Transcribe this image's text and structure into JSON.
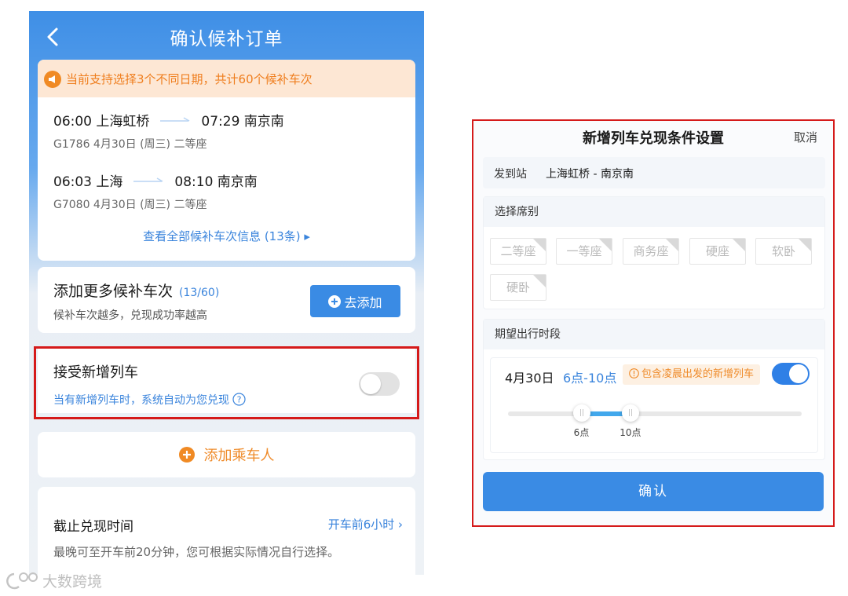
{
  "left": {
    "header": {
      "title": "确认候补订单"
    },
    "notice": {
      "text": "当前支持选择3个不同日期，共计60个候补车次"
    },
    "trains": [
      {
        "depart": "06:00 上海虹桥",
        "arrive": "07:29 南京南",
        "detail": "G1786   4月30日 (周三) 二等座"
      },
      {
        "depart": "06:03 上海",
        "arrive": "08:10 南京南",
        "detail": "G7080   4月30日 (周三) 二等座"
      }
    ],
    "view_all": "查看全部候补车次信息 (13条) ▸",
    "add_more": {
      "title": "添加更多候补车次",
      "count": "(13/60)",
      "subtitle": "候补车次越多，兑现成功率越高",
      "button": "去添加"
    },
    "accept_new": {
      "title": "接受新增列车",
      "subtitle": "当有新增列车时，系统自动为您兑现",
      "toggle_on": false
    },
    "add_passenger": "添加乘车人",
    "deadline": {
      "title": "截止兑现时间",
      "value": "开车前6小时 ›",
      "subtitle": "最晚可至开车前20分钟，您可根据实际情况自行选择。"
    },
    "watermark": "大数跨境"
  },
  "dialog": {
    "title": "新增列车兑现条件设置",
    "cancel": "取消",
    "route_label": "发到站",
    "route_value": "上海虹桥 - 南京南",
    "seat_title": "选择席别",
    "seats": [
      "二等座",
      "一等座",
      "商务座",
      "硬座",
      "软卧",
      "硬卧"
    ],
    "time_title": "期望出行时段",
    "slot": {
      "date": "4月30日",
      "range": "6点-10点",
      "note": "包含凌晨出发的新增列车",
      "enabled": true
    },
    "slider": {
      "min_hour": 0,
      "max_hour": 24,
      "low_hour": 6,
      "high_hour": 10,
      "low_label": "6点",
      "high_label": "10点"
    },
    "confirm": "确认"
  },
  "colors": {
    "brand_blue": "#3a8be4",
    "accent_orange": "#ef8b2a",
    "highlight_red": "#d51a1a"
  }
}
